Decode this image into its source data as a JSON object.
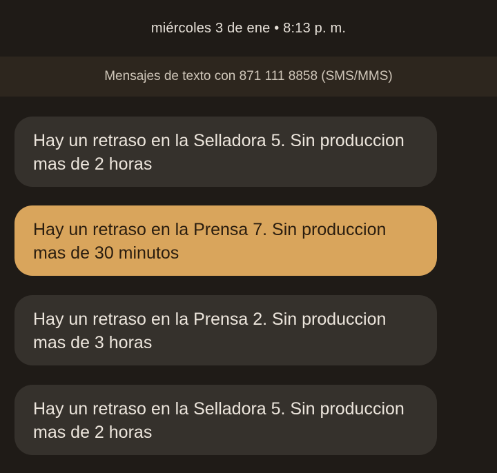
{
  "header": {
    "timestamp": "miércoles 3 de ene • 8:13 p. m."
  },
  "conversation": {
    "banner": "Mensajes de texto con 871 111 8858 (SMS/MMS)"
  },
  "messages": [
    {
      "text": "Hay un retraso en la Selladora 5. Sin produccion mas de 2 horas",
      "highlighted": false
    },
    {
      "text": "Hay un retraso en la Prensa 7. Sin produccion mas de 30 minutos",
      "highlighted": true
    },
    {
      "text": "Hay un retraso en la Prensa 2. Sin produccion mas de 3 horas",
      "highlighted": false
    },
    {
      "text": "Hay un retraso en la Selladora 5. Sin produccion mas de 2 horas",
      "highlighted": false
    }
  ],
  "colors": {
    "background": "#1f1b17",
    "banner": "#2d261e",
    "bubble": "#35312c",
    "highlight": "#d9a55c"
  }
}
